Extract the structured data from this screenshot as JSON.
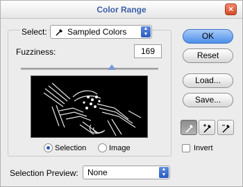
{
  "window": {
    "title": "Color Range",
    "close_glyph": "×"
  },
  "select": {
    "label": "Select:",
    "value": "Sampled Colors",
    "icon": "eyedropper-icon"
  },
  "fuzziness": {
    "label": "Fuzziness:",
    "value": "169",
    "slider_level_fraction": 0.66
  },
  "preview_mode": {
    "options": [
      {
        "label": "Selection",
        "selected": true
      },
      {
        "label": "Image",
        "selected": false
      }
    ]
  },
  "selection_preview": {
    "label": "Selection Preview:",
    "value": "None"
  },
  "buttons": {
    "ok": "OK",
    "reset": "Reset",
    "load": "Load...",
    "save": "Save..."
  },
  "tools": [
    "eyedropper-icon",
    "eyedropper-plus-icon",
    "eyedropper-minus-icon"
  ],
  "invert": {
    "label": "Invert",
    "checked": false
  },
  "colors": {
    "title": "#3b5ea8",
    "accent": "#2a59be",
    "primary_button": "#4d8ee8"
  }
}
